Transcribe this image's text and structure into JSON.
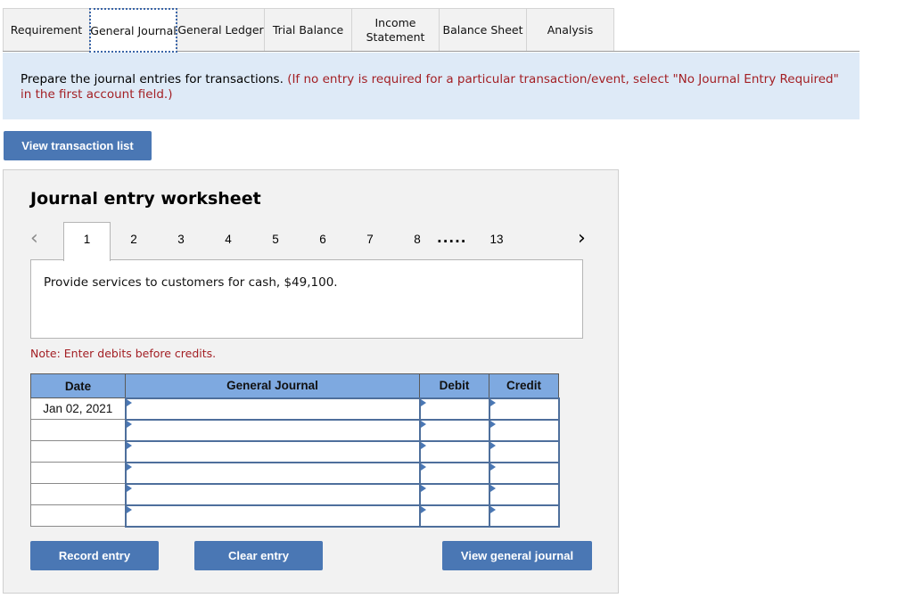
{
  "tabs": [
    {
      "label": "Requirement",
      "active": false
    },
    {
      "label": "General Journal",
      "active": true
    },
    {
      "label": "General Ledger",
      "active": false
    },
    {
      "label": "Trial Balance",
      "active": false
    },
    {
      "label": "Income Statement",
      "active": false
    },
    {
      "label": "Balance Sheet",
      "active": false
    },
    {
      "label": "Analysis",
      "active": false
    }
  ],
  "instructions": {
    "main": "Prepare the journal entries for transactions.",
    "note": "(If no entry is required for a particular transaction/event, select \"No Journal Entry Required\" in the first account field.)"
  },
  "buttons": {
    "view_transaction_list": "View transaction list",
    "record_entry": "Record entry",
    "clear_entry": "Clear entry",
    "view_general_journal": "View general journal"
  },
  "worksheet": {
    "title": "Journal entry worksheet",
    "pager": {
      "prev_icon": "chevron-left-icon",
      "next_icon": "chevron-right-icon",
      "pages": [
        "1",
        "2",
        "3",
        "4",
        "5",
        "6",
        "7",
        "8"
      ],
      "ellipsis": ".....",
      "last_page": "13",
      "active_page": "1"
    },
    "transaction": "Provide services to customers for cash, $49,100.",
    "note": "Note: Enter debits before credits.",
    "table": {
      "headers": [
        "Date",
        "General Journal",
        "Debit",
        "Credit"
      ],
      "rows": [
        {
          "date": "Jan 02, 2021",
          "account": "",
          "debit": "",
          "credit": ""
        },
        {
          "date": "",
          "account": "",
          "debit": "",
          "credit": ""
        },
        {
          "date": "",
          "account": "",
          "debit": "",
          "credit": ""
        },
        {
          "date": "",
          "account": "",
          "debit": "",
          "credit": ""
        },
        {
          "date": "",
          "account": "",
          "debit": "",
          "credit": ""
        },
        {
          "date": "",
          "account": "",
          "debit": "",
          "credit": ""
        }
      ]
    }
  },
  "colors": {
    "accent": "#4a77b4",
    "instruction_bg": "#deeaf7",
    "warning_text": "#a31f24",
    "table_header": "#7ea9e0"
  }
}
